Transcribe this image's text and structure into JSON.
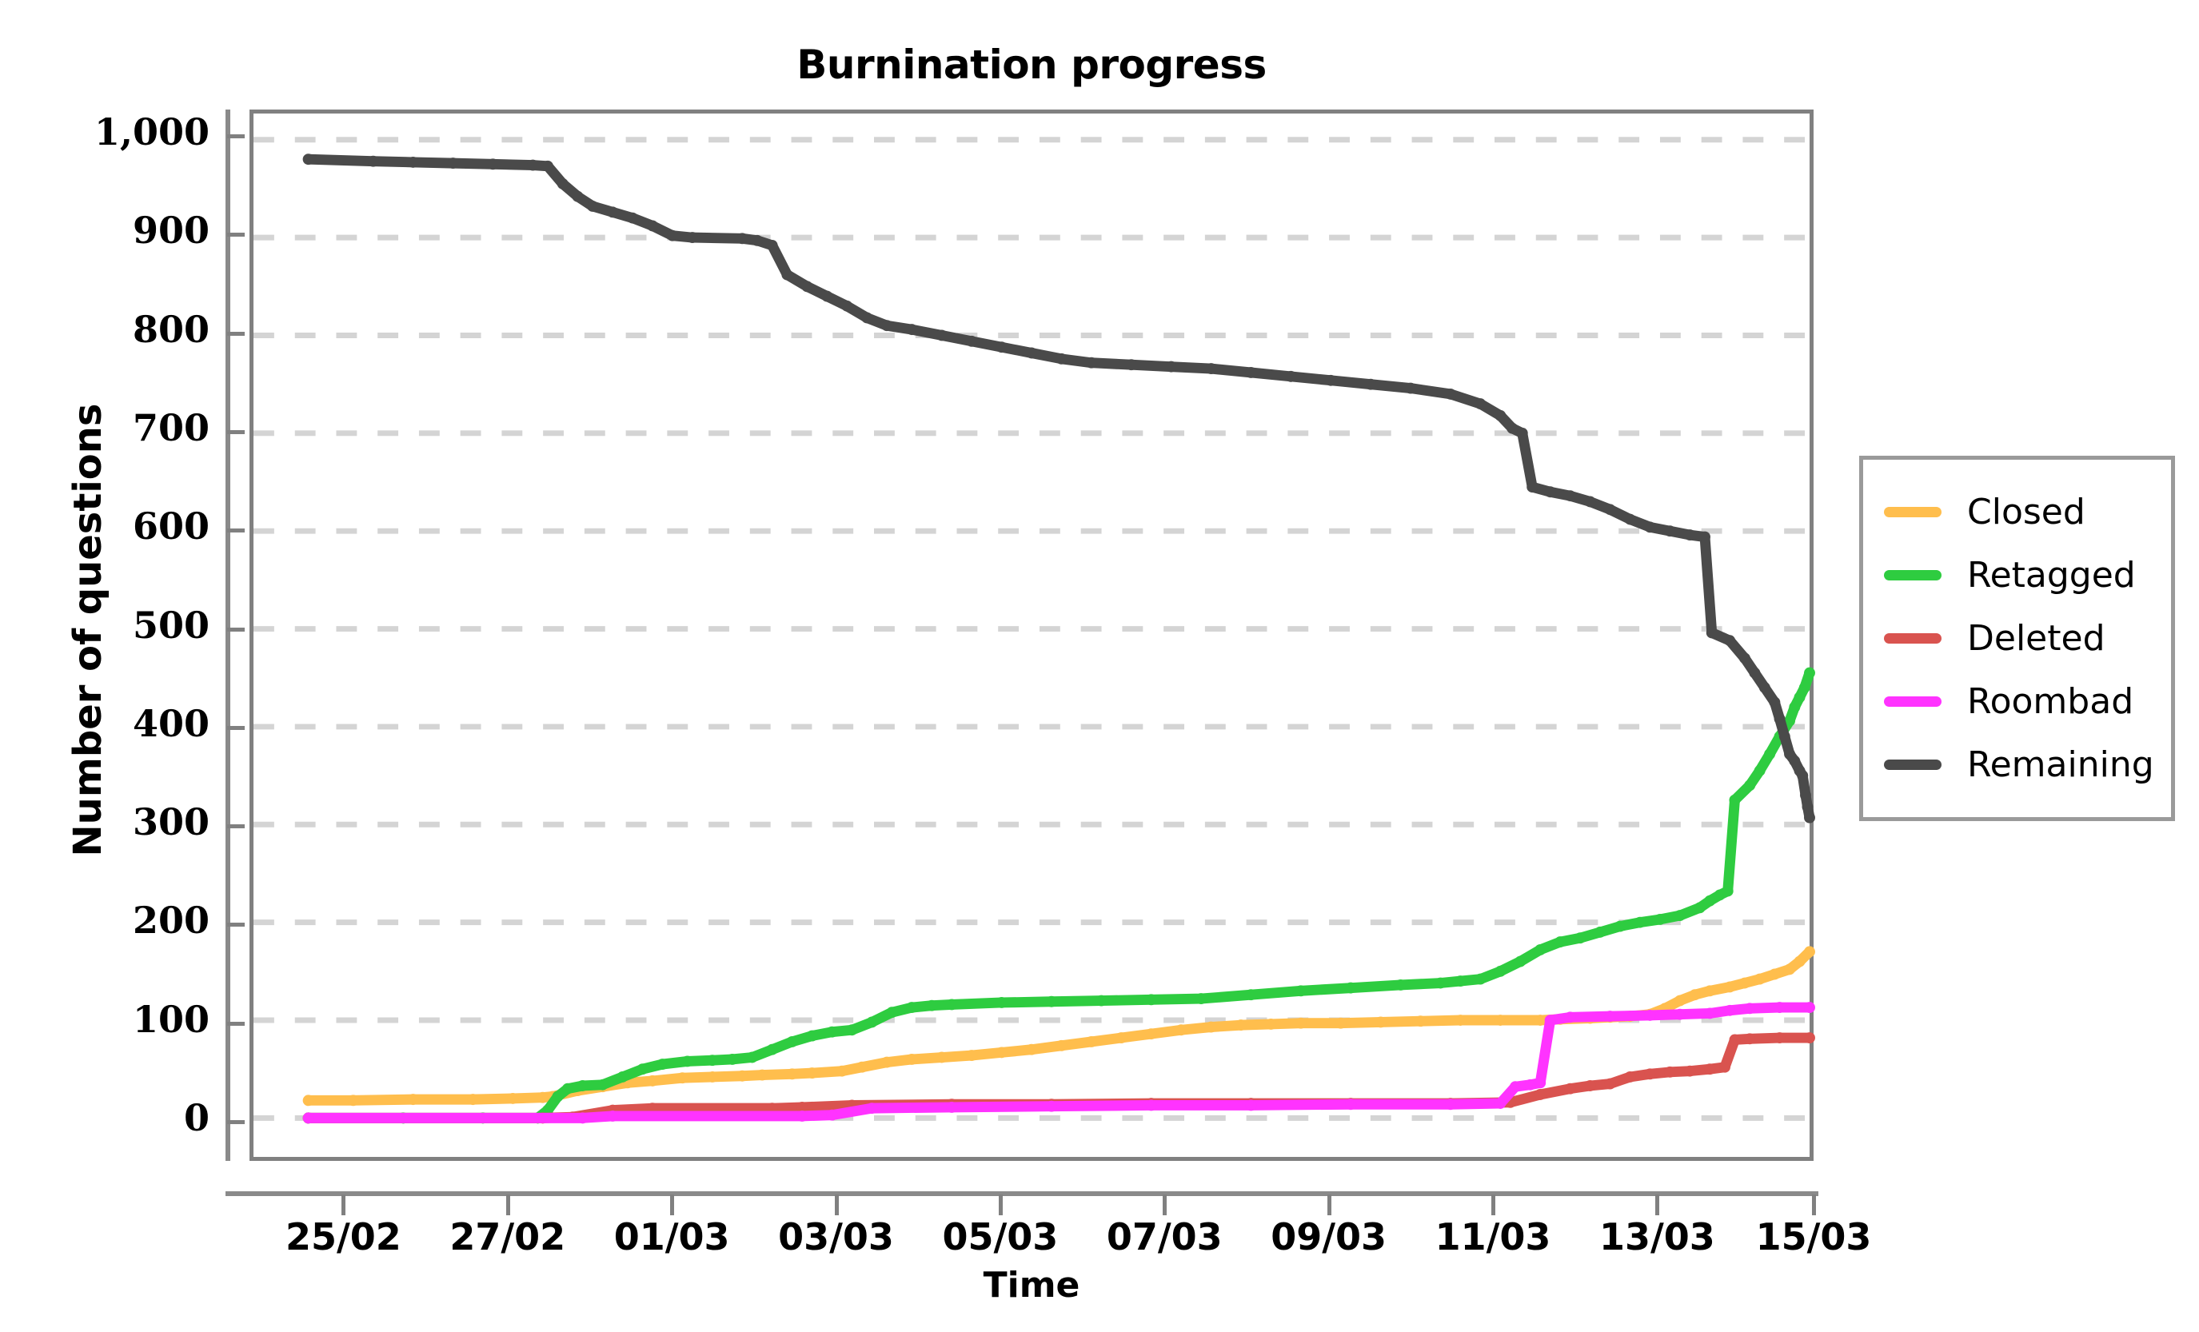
{
  "chart_data": {
    "type": "line",
    "title": "Burnination progress",
    "xlabel": "Time",
    "ylabel": "Number of questions",
    "grid": true,
    "legend_position": "right",
    "ylim": [
      0,
      1000
    ],
    "yticks": [
      0,
      100,
      200,
      300,
      400,
      500,
      600,
      700,
      800,
      900,
      1000
    ],
    "ytick_labels": [
      "0",
      "100",
      "200",
      "300",
      "400",
      "500",
      "600",
      "700",
      "800",
      "900",
      "1,000"
    ],
    "xtick_labels": [
      "25/02",
      "27/02",
      "01/03",
      "03/03",
      "05/03",
      "07/03",
      "09/03",
      "11/03",
      "13/03",
      "15/03"
    ],
    "xtick_positions": [
      0.06,
      0.165,
      0.27,
      0.375,
      0.48,
      0.585,
      0.69,
      0.795,
      0.9,
      1.0
    ],
    "xlim_days": [
      24.0,
      39.6
    ],
    "colors": {
      "closed": "#FFBE4D",
      "retagged": "#2ECC40",
      "deleted": "#D9534F",
      "roombad": "#FF33FF",
      "remaining": "#4A4A4A"
    },
    "series": [
      {
        "name": "Closed",
        "color": "#FFBE4D",
        "final_value": 170,
        "points": [
          [
            24.55,
            18
          ],
          [
            25.0,
            18
          ],
          [
            25.6,
            19
          ],
          [
            26.2,
            19
          ],
          [
            26.6,
            20
          ],
          [
            26.9,
            21
          ],
          [
            27.0,
            22
          ],
          [
            27.25,
            28
          ],
          [
            27.5,
            32
          ],
          [
            27.75,
            36
          ],
          [
            28.0,
            38
          ],
          [
            28.3,
            41
          ],
          [
            28.6,
            42
          ],
          [
            28.9,
            43
          ],
          [
            29.1,
            44
          ],
          [
            29.4,
            45
          ],
          [
            29.6,
            46
          ],
          [
            29.9,
            48
          ],
          [
            30.1,
            52
          ],
          [
            30.35,
            57
          ],
          [
            30.6,
            60
          ],
          [
            30.9,
            62
          ],
          [
            31.2,
            64
          ],
          [
            31.5,
            67
          ],
          [
            31.8,
            70
          ],
          [
            32.1,
            74
          ],
          [
            32.4,
            78
          ],
          [
            32.7,
            82
          ],
          [
            33.0,
            86
          ],
          [
            33.3,
            90
          ],
          [
            33.6,
            93
          ],
          [
            33.9,
            95
          ],
          [
            34.2,
            96
          ],
          [
            34.5,
            97
          ],
          [
            34.9,
            97
          ],
          [
            35.3,
            98
          ],
          [
            35.7,
            99
          ],
          [
            36.1,
            100
          ],
          [
            36.5,
            100
          ],
          [
            36.9,
            100
          ],
          [
            37.1,
            101
          ],
          [
            37.4,
            102
          ],
          [
            37.6,
            103
          ],
          [
            37.8,
            104
          ],
          [
            38.0,
            106
          ],
          [
            38.15,
            112
          ],
          [
            38.3,
            120
          ],
          [
            38.45,
            126
          ],
          [
            38.6,
            130
          ],
          [
            38.8,
            134
          ],
          [
            38.95,
            138
          ],
          [
            39.1,
            142
          ],
          [
            39.25,
            147
          ],
          [
            39.4,
            152
          ],
          [
            39.5,
            160
          ],
          [
            39.6,
            170
          ]
        ]
      },
      {
        "name": "Retagged",
        "color": "#2ECC40",
        "final_value": 455,
        "points": [
          [
            24.55,
            0
          ],
          [
            25.5,
            0
          ],
          [
            26.3,
            0
          ],
          [
            26.85,
            0
          ],
          [
            26.95,
            8
          ],
          [
            27.05,
            22
          ],
          [
            27.15,
            30
          ],
          [
            27.3,
            33
          ],
          [
            27.5,
            34
          ],
          [
            27.7,
            42
          ],
          [
            27.9,
            50
          ],
          [
            28.1,
            55
          ],
          [
            28.35,
            58
          ],
          [
            28.6,
            59
          ],
          [
            28.8,
            60
          ],
          [
            29.0,
            62
          ],
          [
            29.2,
            70
          ],
          [
            29.4,
            78
          ],
          [
            29.6,
            84
          ],
          [
            29.8,
            88
          ],
          [
            30.0,
            90
          ],
          [
            30.2,
            98
          ],
          [
            30.4,
            108
          ],
          [
            30.6,
            113
          ],
          [
            30.8,
            115
          ],
          [
            31.0,
            116
          ],
          [
            31.5,
            118
          ],
          [
            32.0,
            119
          ],
          [
            32.5,
            120
          ],
          [
            33.0,
            121
          ],
          [
            33.5,
            122
          ],
          [
            34.0,
            126
          ],
          [
            34.5,
            130
          ],
          [
            35.0,
            133
          ],
          [
            35.5,
            136
          ],
          [
            35.9,
            138
          ],
          [
            36.1,
            140
          ],
          [
            36.3,
            142
          ],
          [
            36.5,
            150
          ],
          [
            36.7,
            160
          ],
          [
            36.9,
            172
          ],
          [
            37.1,
            180
          ],
          [
            37.3,
            184
          ],
          [
            37.5,
            190
          ],
          [
            37.7,
            196
          ],
          [
            37.9,
            200
          ],
          [
            38.1,
            203
          ],
          [
            38.3,
            207
          ],
          [
            38.5,
            215
          ],
          [
            38.6,
            222
          ],
          [
            38.7,
            228
          ],
          [
            38.78,
            232
          ],
          [
            38.85,
            325
          ],
          [
            39.0,
            340
          ],
          [
            39.1,
            355
          ],
          [
            39.2,
            372
          ],
          [
            39.3,
            390
          ],
          [
            39.4,
            406
          ],
          [
            39.45,
            420
          ],
          [
            39.5,
            430
          ],
          [
            39.55,
            440
          ],
          [
            39.6,
            455
          ]
        ]
      },
      {
        "name": "Deleted",
        "color": "#D9534F",
        "final_value": 82,
        "points": [
          [
            24.55,
            0
          ],
          [
            26.9,
            0
          ],
          [
            27.2,
            1
          ],
          [
            27.6,
            8
          ],
          [
            28.0,
            10
          ],
          [
            29.2,
            10
          ],
          [
            29.5,
            11
          ],
          [
            30.0,
            13
          ],
          [
            31.0,
            14
          ],
          [
            32.0,
            14
          ],
          [
            33.0,
            15
          ],
          [
            34.0,
            15
          ],
          [
            35.0,
            15
          ],
          [
            36.0,
            15
          ],
          [
            36.6,
            16
          ],
          [
            36.9,
            24
          ],
          [
            37.2,
            30
          ],
          [
            37.4,
            33
          ],
          [
            37.6,
            35
          ],
          [
            37.8,
            42
          ],
          [
            38.0,
            45
          ],
          [
            38.2,
            47
          ],
          [
            38.4,
            48
          ],
          [
            38.6,
            50
          ],
          [
            38.75,
            52
          ],
          [
            38.85,
            80
          ],
          [
            39.0,
            81
          ],
          [
            39.3,
            82
          ],
          [
            39.6,
            82
          ]
        ]
      },
      {
        "name": "Roombad",
        "color": "#FF33FF",
        "final_value": 113,
        "points": [
          [
            24.55,
            0
          ],
          [
            27.3,
            0
          ],
          [
            27.6,
            2
          ],
          [
            29.5,
            2
          ],
          [
            29.8,
            3
          ],
          [
            30.2,
            10
          ],
          [
            31.0,
            11
          ],
          [
            32.0,
            12
          ],
          [
            33.0,
            13
          ],
          [
            34.0,
            13
          ],
          [
            35.0,
            14
          ],
          [
            36.0,
            14
          ],
          [
            36.5,
            15
          ],
          [
            36.65,
            32
          ],
          [
            36.8,
            34
          ],
          [
            36.9,
            36
          ],
          [
            37.0,
            100
          ],
          [
            37.2,
            103
          ],
          [
            37.6,
            104
          ],
          [
            38.0,
            105
          ],
          [
            38.3,
            106
          ],
          [
            38.6,
            107
          ],
          [
            38.8,
            110
          ],
          [
            39.0,
            112
          ],
          [
            39.3,
            113
          ],
          [
            39.6,
            113
          ]
        ]
      },
      {
        "name": "Remaining",
        "color": "#4A4A4A",
        "final_value": 307,
        "points": [
          [
            24.55,
            980
          ],
          [
            25.2,
            978
          ],
          [
            25.6,
            977
          ],
          [
            26.0,
            976
          ],
          [
            26.4,
            975
          ],
          [
            26.8,
            974
          ],
          [
            26.95,
            973
          ],
          [
            27.1,
            955
          ],
          [
            27.25,
            942
          ],
          [
            27.4,
            932
          ],
          [
            27.6,
            926
          ],
          [
            27.8,
            920
          ],
          [
            28.0,
            912
          ],
          [
            28.2,
            902
          ],
          [
            28.4,
            900
          ],
          [
            28.9,
            899
          ],
          [
            29.05,
            897
          ],
          [
            29.2,
            892
          ],
          [
            29.35,
            862
          ],
          [
            29.55,
            850
          ],
          [
            29.75,
            840
          ],
          [
            29.95,
            830
          ],
          [
            30.15,
            818
          ],
          [
            30.35,
            810
          ],
          [
            30.6,
            806
          ],
          [
            30.9,
            800
          ],
          [
            31.2,
            794
          ],
          [
            31.5,
            788
          ],
          [
            31.8,
            782
          ],
          [
            32.1,
            776
          ],
          [
            32.4,
            772
          ],
          [
            32.8,
            770
          ],
          [
            33.2,
            768
          ],
          [
            33.6,
            766
          ],
          [
            34.0,
            762
          ],
          [
            34.4,
            758
          ],
          [
            34.8,
            754
          ],
          [
            35.2,
            750
          ],
          [
            35.6,
            746
          ],
          [
            36.0,
            740
          ],
          [
            36.3,
            730
          ],
          [
            36.5,
            718
          ],
          [
            36.62,
            705
          ],
          [
            36.72,
            700
          ],
          [
            36.82,
            645
          ],
          [
            37.0,
            640
          ],
          [
            37.2,
            636
          ],
          [
            37.4,
            630
          ],
          [
            37.6,
            622
          ],
          [
            37.8,
            612
          ],
          [
            38.0,
            604
          ],
          [
            38.2,
            600
          ],
          [
            38.4,
            596
          ],
          [
            38.55,
            594
          ],
          [
            38.62,
            496
          ],
          [
            38.8,
            488
          ],
          [
            38.95,
            470
          ],
          [
            39.05,
            455
          ],
          [
            39.15,
            440
          ],
          [
            39.25,
            425
          ],
          [
            39.3,
            408
          ],
          [
            39.35,
            390
          ],
          [
            39.4,
            372
          ],
          [
            39.45,
            365
          ],
          [
            39.5,
            355
          ],
          [
            39.53,
            350
          ],
          [
            39.56,
            330
          ],
          [
            39.58,
            318
          ],
          [
            39.6,
            307
          ]
        ]
      }
    ]
  },
  "legend": {
    "items": [
      {
        "label": "Closed",
        "color": "#FFBE4D"
      },
      {
        "label": "Retagged",
        "color": "#2ECC40"
      },
      {
        "label": "Deleted",
        "color": "#D9534F"
      },
      {
        "label": "Roombad",
        "color": "#FF33FF"
      },
      {
        "label": "Remaining",
        "color": "#4A4A4A"
      }
    ]
  }
}
